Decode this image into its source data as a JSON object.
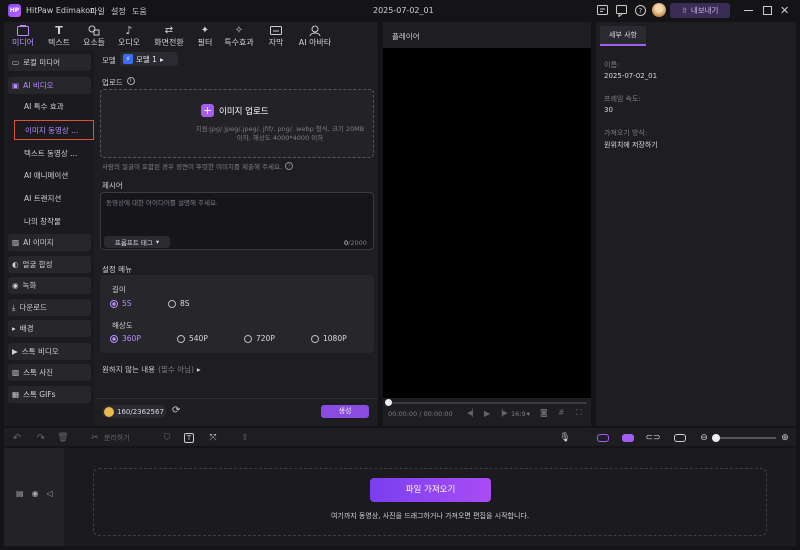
{
  "app": {
    "name": "HitPaw Edimakor",
    "project_title": "2025-07-02_01",
    "export_label": "내보내기"
  },
  "menu": [
    "파일",
    "설정",
    "도움"
  ],
  "media_tabs": [
    {
      "label": "미디어",
      "icon": "media-icon"
    },
    {
      "label": "텍스트",
      "icon": "text-icon"
    },
    {
      "label": "요소들",
      "icon": "elements-icon"
    },
    {
      "label": "오디오",
      "icon": "audio-icon"
    },
    {
      "label": "화면전환",
      "icon": "transition-icon"
    },
    {
      "label": "필터",
      "icon": "filter-icon"
    },
    {
      "label": "특수효과",
      "icon": "effects-icon"
    },
    {
      "label": "자막",
      "icon": "subtitle-icon"
    },
    {
      "label": "AI 아바타",
      "icon": "avatar-icon"
    }
  ],
  "sidebar": {
    "local_media": "로컬 미디어",
    "ai_video": "AI 비디오",
    "sub_items": [
      "AI 특수 효과",
      "이미지 동영상 ...",
      "텍스트 동영상 ...",
      "AI 애니메이션",
      "AI 트랜지션",
      "나의 창작물"
    ],
    "items": [
      "AI 이미지",
      "얼굴 합성",
      "녹화",
      "다운로드",
      "배경",
      "스톡 비디오",
      "스톡 사진",
      "스톡 GIFs"
    ]
  },
  "form": {
    "model_label": "모델",
    "model_value": "모델 1",
    "upload_label": "업로드",
    "upload_button": "이미지 업로드",
    "upload_hint": "지원:jpg/.jpeg/.jpeg/. jfif/. png/. webp 형식, 크기 20MB 이하, 해상도 4000*4000 이하",
    "face_notice": "사람의 얼굴이 포함된 경우 정면이 뚜렷한 이미지를 제출해 주세요.",
    "prompt_label": "제시어",
    "prompt_placeholder": "동영상에 대한 아이디어를 설명해 주세요.",
    "prompt_tag": "프롬프트 태그",
    "char_count": "0",
    "char_max": "/2000",
    "settings_menu": "설정 메뉴",
    "length_label": "길이",
    "length_options": [
      "5S",
      "8S"
    ],
    "length_selected": 0,
    "resolution_label": "해상도",
    "resolution_options": [
      "360P",
      "540P",
      "720P",
      "1080P"
    ],
    "resolution_selected": 0,
    "negative_label": "원하지 않는 내용",
    "negative_optional": "(필수 아님)",
    "credits": "160/2362567",
    "generate_button": "생성"
  },
  "player": {
    "title": "플레이어",
    "time": "00:00:00 / 00:00:00",
    "ratio": "16:9"
  },
  "details": {
    "tab": "세부 사항",
    "name_label": "이름:",
    "name_value": "2025-07-02_01",
    "fps_label": "프레임 속도:",
    "fps_value": "30",
    "import_label": "가져오기 방식:",
    "import_value": "원위치에 저장하기"
  },
  "timeline": {
    "split_label": "분리하기",
    "import_button": "파일 가져오기",
    "drop_hint": "여기까지 동영상, 사진을 드래그하거나 가져오면 편집을 시작합니다."
  },
  "colors": {
    "accent": "#a55cf5",
    "selected_border": "#e0503a",
    "panel": "#1e1e22"
  }
}
